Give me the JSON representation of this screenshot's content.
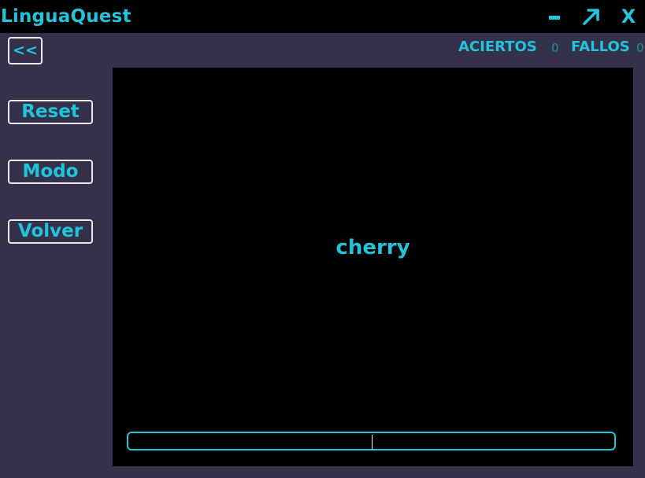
{
  "window": {
    "title": "LinguaQuest",
    "maximize_glyph": "↗",
    "close_glyph": "X",
    "icons": {
      "minimize": "minimize-icon",
      "maximize": "maximize-icon",
      "close": "close-icon"
    }
  },
  "sidebar": {
    "back_label": "<<",
    "reset_label": "Reset",
    "mode_label": "Modo",
    "back_home_label": "Volver"
  },
  "score": {
    "correct_label": "ACIERTOS",
    "correct_value": "0",
    "wrong_label": "FALLOS",
    "wrong_value": "0"
  },
  "card": {
    "word": "cherry"
  },
  "answer": {
    "value": ""
  },
  "colors": {
    "background": "#34314a",
    "panel": "#000000",
    "accent": "#22c4dc",
    "button_border": "#e8e8f0"
  }
}
